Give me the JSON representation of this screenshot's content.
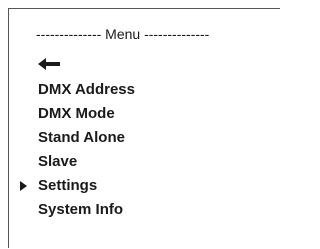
{
  "menu": {
    "title": "-------------- Menu --------------",
    "back_icon": "left-arrow-icon",
    "items": [
      {
        "label": "DMX Address",
        "selected": false
      },
      {
        "label": "DMX Mode",
        "selected": false
      },
      {
        "label": "Stand Alone",
        "selected": false
      },
      {
        "label": "Slave",
        "selected": false
      },
      {
        "label": "Settings",
        "selected": true
      },
      {
        "label": "System Info",
        "selected": false
      }
    ]
  }
}
